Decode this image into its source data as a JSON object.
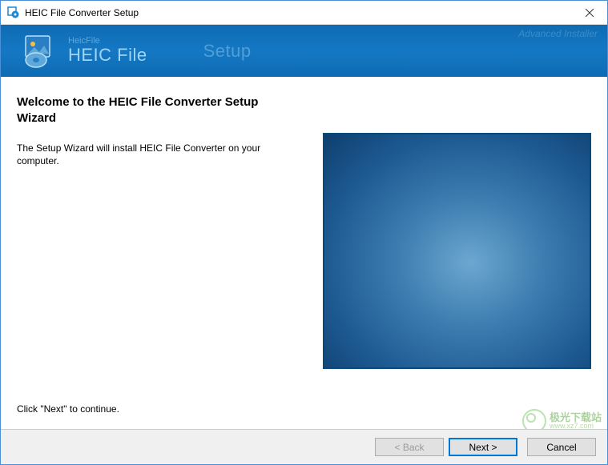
{
  "titlebar": {
    "title": "HEIC File Converter Setup"
  },
  "banner": {
    "small": "HeicFile",
    "large": "HEIC File",
    "setup": "Setup",
    "advanced": "Advanced Installer"
  },
  "content": {
    "heading": "Welcome to the HEIC File Converter Setup Wizard",
    "description": "The Setup Wizard will install HEIC File Converter on your computer.",
    "continue": "Click \"Next\" to continue."
  },
  "buttons": {
    "back": "< Back",
    "next": "Next >",
    "cancel": "Cancel"
  },
  "watermark": {
    "cn": "极光下载站",
    "url": "www.xz7.com"
  }
}
